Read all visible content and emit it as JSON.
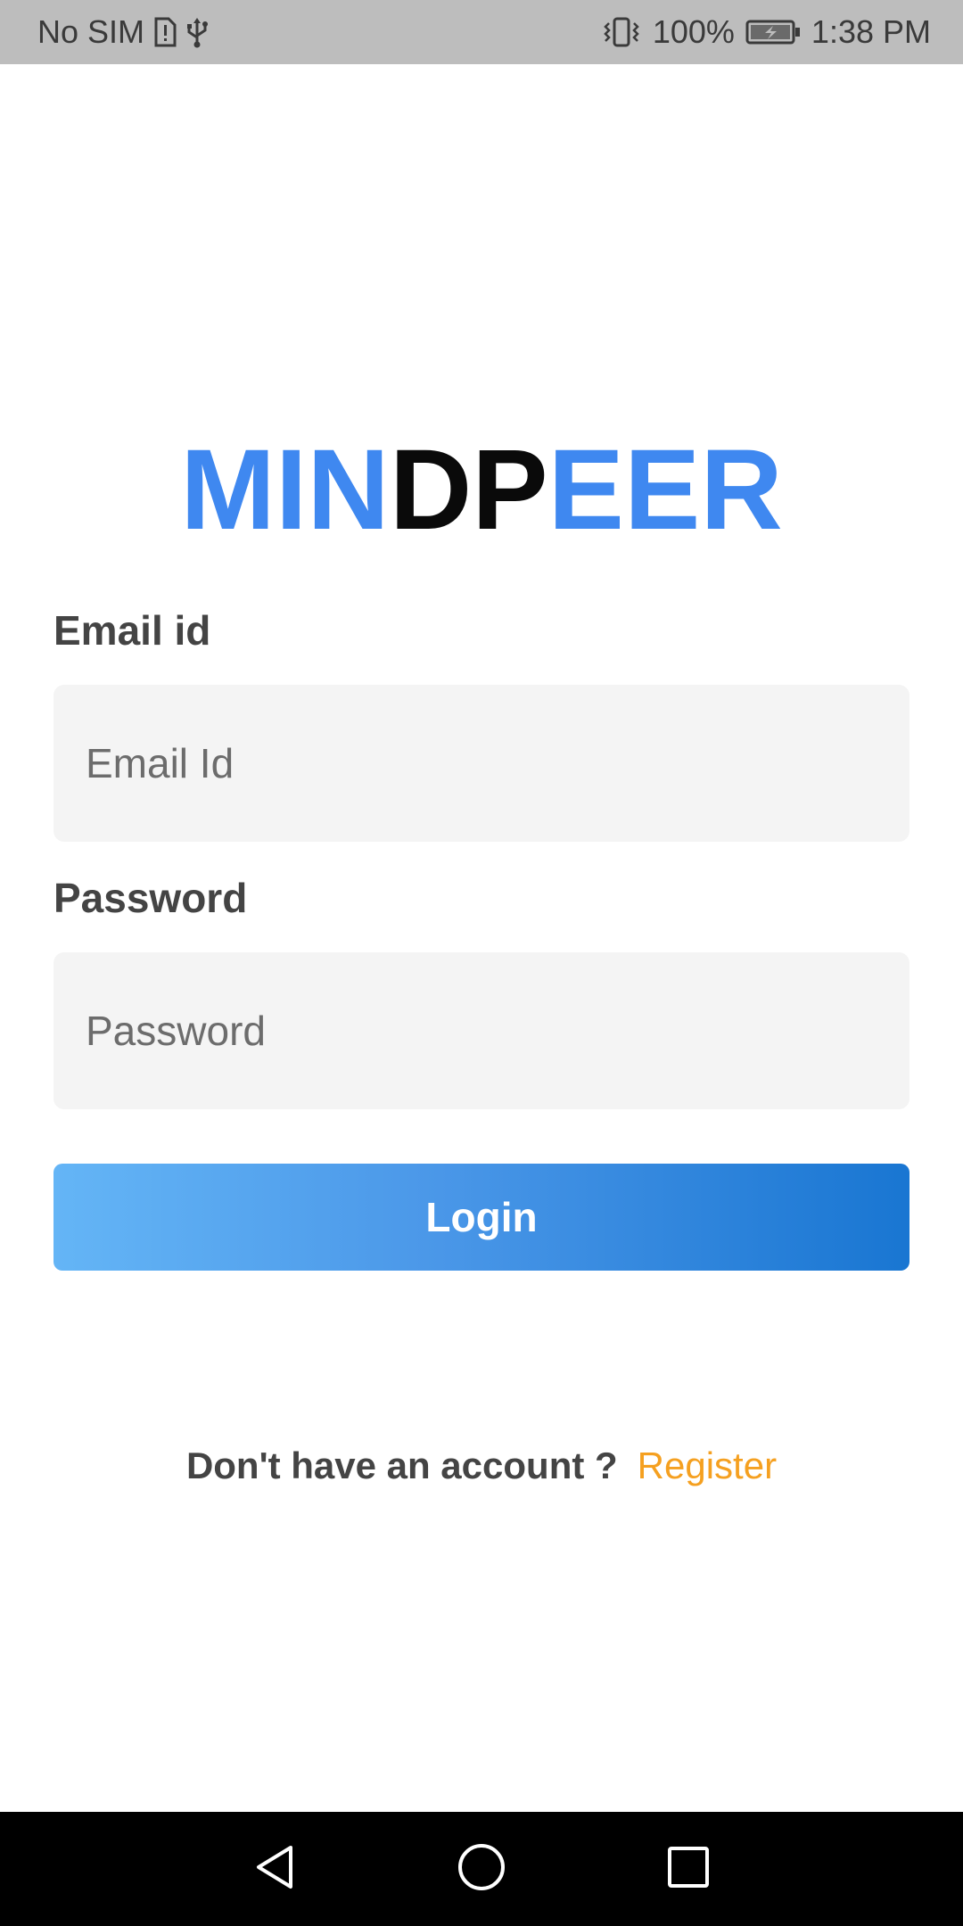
{
  "status_bar": {
    "carrier": "No SIM",
    "battery_percent": "100%",
    "time": "1:38 PM",
    "icons": [
      "sim-alert-icon",
      "usb-icon",
      "vibrate-icon",
      "battery-charging-icon"
    ]
  },
  "logo": {
    "part1": "MIN",
    "part2": "DP",
    "part3": "EER",
    "colors": {
      "accent": "#3f88f0",
      "dark": "#0a0a0a"
    }
  },
  "form": {
    "email_label": "Email id",
    "email_placeholder": "Email Id",
    "email_value": "",
    "password_label": "Password",
    "password_placeholder": "Password",
    "password_value": ""
  },
  "login_button": {
    "label": "Login",
    "gradient": [
      "#64b5f6",
      "#1976d2"
    ]
  },
  "register": {
    "prompt": "Don't have an account ?",
    "link": "Register",
    "link_color": "#f5a020"
  },
  "nav_bar": {
    "buttons": [
      "back-icon",
      "home-icon",
      "recents-icon"
    ]
  }
}
